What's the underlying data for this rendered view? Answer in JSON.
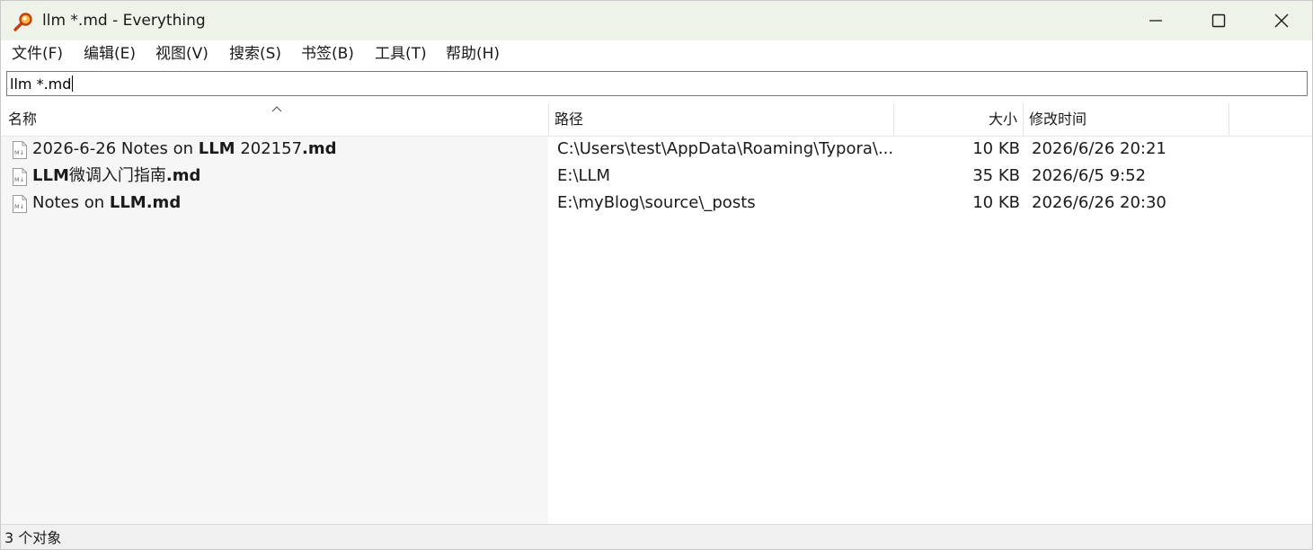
{
  "window": {
    "title": "llm *.md - Everything"
  },
  "menu": [
    {
      "label": "文件(F)"
    },
    {
      "label": "编辑(E)"
    },
    {
      "label": "视图(V)"
    },
    {
      "label": "搜索(S)"
    },
    {
      "label": "书签(B)"
    },
    {
      "label": "工具(T)"
    },
    {
      "label": "帮助(H)"
    }
  ],
  "search": {
    "value": "llm *.md"
  },
  "columns": {
    "name": "名称",
    "path": "路径",
    "size": "大小",
    "modified": "修改时间"
  },
  "sort": {
    "column": "name",
    "direction": "ascending"
  },
  "rows": [
    {
      "name_parts": [
        {
          "text": "2026-6-26 Notes on ",
          "bold": false
        },
        {
          "text": "LLM",
          "bold": true
        },
        {
          "text": " 202157",
          "bold": false
        },
        {
          "text": ".md",
          "bold": true
        }
      ],
      "path": "C:\\Users\\test\\AppData\\Roaming\\Typora\\...",
      "size": "10 KB",
      "modified": "2026/6/26 20:21"
    },
    {
      "name_parts": [
        {
          "text": "LLM",
          "bold": true
        },
        {
          "text": "微调入门指南",
          "bold": false
        },
        {
          "text": ".md",
          "bold": true
        }
      ],
      "path": "E:\\LLM",
      "size": "35 KB",
      "modified": "2026/6/5 9:52"
    },
    {
      "name_parts": [
        {
          "text": "Notes on ",
          "bold": false
        },
        {
          "text": "LLM",
          "bold": true
        },
        {
          "text": ".md",
          "bold": true
        }
      ],
      "path": "E:\\myBlog\\source\\_posts",
      "size": "10 KB",
      "modified": "2026/6/26 20:30"
    }
  ],
  "status": {
    "text": "3 个对象"
  },
  "icons": {
    "app": "magnifier-icon",
    "file": "markdown-file-icon"
  },
  "colors": {
    "titlebar": "#eef3ea",
    "name_column": "#f6f6f6",
    "statusbar": "#f0f0f0"
  }
}
